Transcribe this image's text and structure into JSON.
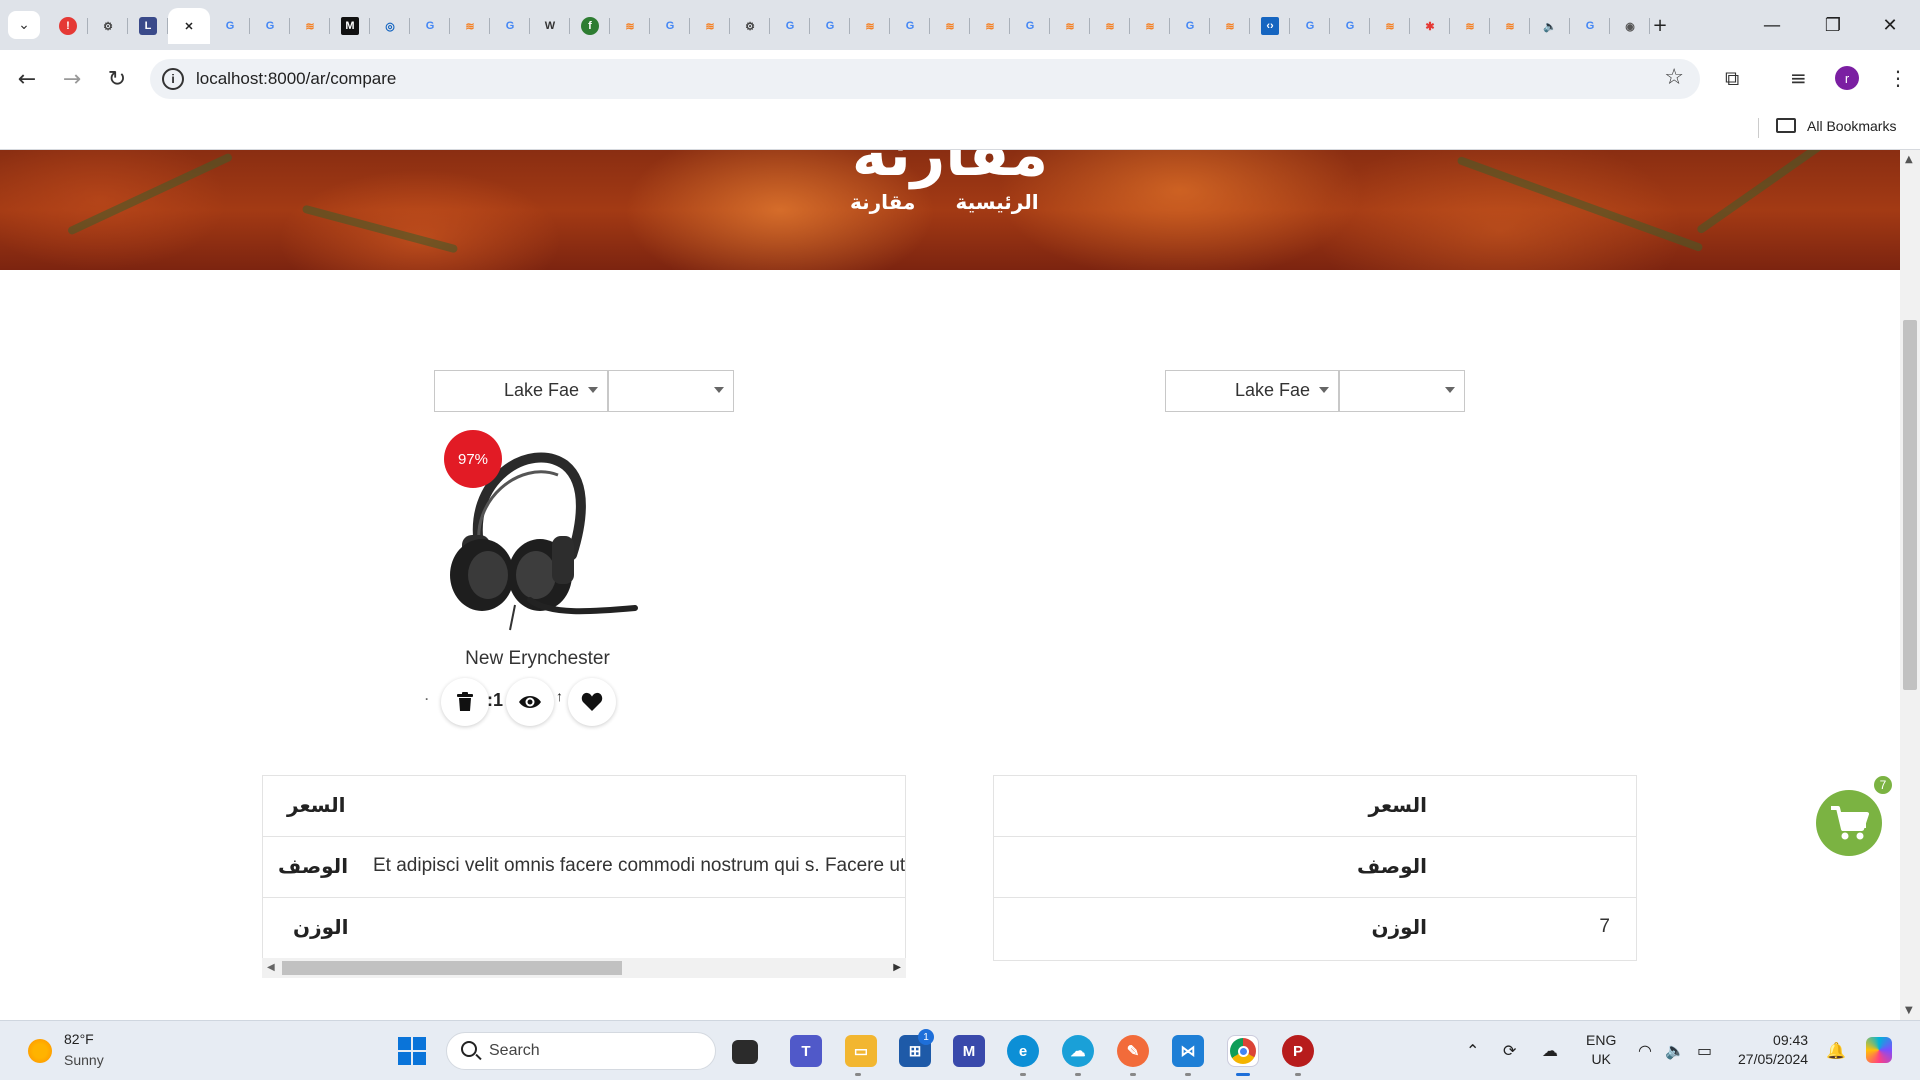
{
  "browser": {
    "tabs": [
      {
        "icon": "warning-icon",
        "color": "#e53935",
        "glyph": "!"
      },
      {
        "icon": "openai-icon",
        "color": "#444444",
        "glyph": "⚙"
      },
      {
        "icon": "clock-app-icon",
        "color": "#3a4a8a",
        "glyph": "L"
      },
      {
        "icon": "close-icon",
        "color": "#222222",
        "glyph": "✕",
        "active": true
      },
      {
        "icon": "google-icon",
        "color": "#4285f4",
        "glyph": "G"
      },
      {
        "icon": "google-icon",
        "color": "#4285f4",
        "glyph": "G"
      },
      {
        "icon": "stackoverflow-icon",
        "color": "#f48024",
        "glyph": "≋"
      },
      {
        "icon": "medium-icon",
        "color": "#111111",
        "glyph": "M"
      },
      {
        "icon": "circle-app-icon",
        "color": "#1565c0",
        "glyph": "◎"
      },
      {
        "icon": "google-icon",
        "color": "#4285f4",
        "glyph": "G"
      },
      {
        "icon": "stackoverflow-icon",
        "color": "#f48024",
        "glyph": "≋"
      },
      {
        "icon": "google-icon",
        "color": "#4285f4",
        "glyph": "G"
      },
      {
        "icon": "wikipedia-icon",
        "color": "#333333",
        "glyph": "W"
      },
      {
        "icon": "green-app-icon",
        "color": "#2e7d32",
        "glyph": "f"
      },
      {
        "icon": "stackoverflow-icon",
        "color": "#f48024",
        "glyph": "≋"
      },
      {
        "icon": "google-icon",
        "color": "#4285f4",
        "glyph": "G"
      },
      {
        "icon": "stackoverflow-icon",
        "color": "#f48024",
        "glyph": "≋"
      },
      {
        "icon": "openai-icon",
        "color": "#444444",
        "glyph": "⚙"
      },
      {
        "icon": "google-icon",
        "color": "#4285f4",
        "glyph": "G"
      },
      {
        "icon": "google-icon",
        "color": "#4285f4",
        "glyph": "G"
      },
      {
        "icon": "stackoverflow-icon",
        "color": "#f48024",
        "glyph": "≋"
      },
      {
        "icon": "google-icon",
        "color": "#4285f4",
        "glyph": "G"
      },
      {
        "icon": "stackoverflow-icon",
        "color": "#f48024",
        "glyph": "≋"
      },
      {
        "icon": "stackoverflow-icon",
        "color": "#f48024",
        "glyph": "≋"
      },
      {
        "icon": "google-icon",
        "color": "#4285f4",
        "glyph": "G"
      },
      {
        "icon": "stackoverflow-icon",
        "color": "#f48024",
        "glyph": "≋"
      },
      {
        "icon": "stackoverflow-icon",
        "color": "#f48024",
        "glyph": "≋"
      },
      {
        "icon": "stackoverflow-icon",
        "color": "#f48024",
        "glyph": "≋"
      },
      {
        "icon": "google-icon",
        "color": "#4285f4",
        "glyph": "G"
      },
      {
        "icon": "stackoverflow-icon",
        "color": "#f48024",
        "glyph": "≋"
      },
      {
        "icon": "code-app-icon",
        "color": "#1565c0",
        "glyph": "‹›"
      },
      {
        "icon": "google-icon",
        "color": "#4285f4",
        "glyph": "G"
      },
      {
        "icon": "google-icon",
        "color": "#4285f4",
        "glyph": "G"
      },
      {
        "icon": "stackoverflow-icon",
        "color": "#f48024",
        "glyph": "≋"
      },
      {
        "icon": "asterisk-app-icon",
        "color": "#e53935",
        "glyph": "✱"
      },
      {
        "icon": "stackoverflow-icon",
        "color": "#f48024",
        "glyph": "≋"
      },
      {
        "icon": "stackoverflow-icon",
        "color": "#f48024",
        "glyph": "≋"
      },
      {
        "icon": "speaker-icon",
        "color": "#333333",
        "glyph": "🔈"
      },
      {
        "icon": "google-icon",
        "color": "#4285f4",
        "glyph": "G"
      },
      {
        "icon": "chrome-icon",
        "color": "#555555",
        "glyph": "◉"
      }
    ],
    "new_tab": "+",
    "url": "localhost:8000/ar/compare",
    "profile_initial": "r",
    "bookmarks_label": "All Bookmarks"
  },
  "page": {
    "hero_title": "مقارنة",
    "breadcrumb": {
      "home": "الرئيسية",
      "current": "مقارنة"
    },
    "selects": {
      "left": {
        "store": "Lake Fae",
        "product": ""
      },
      "right": {
        "store": "Lake Fae",
        "product": ""
      }
    },
    "product": {
      "discount": "97%",
      "name": "New Erynchester",
      "stray_quantity": ":1",
      "stray_arrow": "↑",
      "stray_dot": "·"
    },
    "left_table": {
      "rows": [
        {
          "label": "السعر",
          "value": ""
        },
        {
          "label": "الوصف",
          "value": "Et adipisci velit omnis facere commodi nostrum qui s. Facere ut"
        },
        {
          "label": "الوزن",
          "value": ""
        }
      ]
    },
    "right_table": {
      "rows": [
        {
          "label": "السعر",
          "value": ""
        },
        {
          "label": "الوصف",
          "value": ""
        },
        {
          "label": "الوزن",
          "value": "7"
        }
      ]
    },
    "cart_count": "7"
  },
  "taskbar": {
    "weather_temp": "82°F",
    "weather_cond": "Sunny",
    "search_placeholder": "Search",
    "store_badge": "1",
    "lang_top": "ENG",
    "lang_bottom": "UK",
    "time": "09:43",
    "date": "27/05/2024"
  },
  "colors": {
    "accent_red": "#e21b25",
    "cart_green": "#7bb342"
  }
}
